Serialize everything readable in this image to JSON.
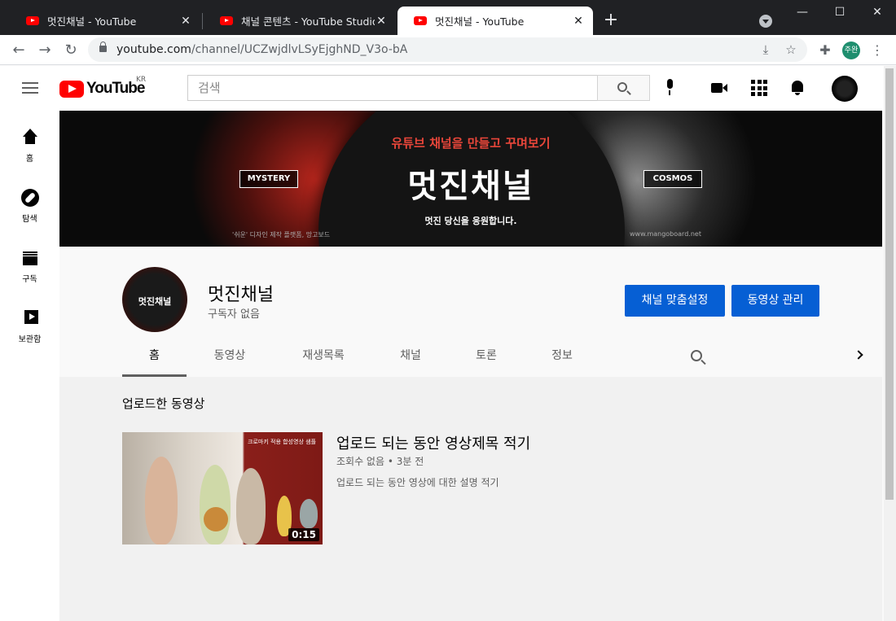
{
  "browser": {
    "tabs": [
      {
        "title": "멋진채널 - YouTube",
        "close": "✕"
      },
      {
        "title": "채널 콘텐츠 - YouTube Studio",
        "close": "✕"
      },
      {
        "title": "멋진채널 - YouTube",
        "close": "✕"
      }
    ],
    "new_tab": "+",
    "window_controls": {
      "minimize": "—",
      "maximize": "☐",
      "close": "✕"
    },
    "url_host": "youtube.com",
    "url_path": "/channel/UCZwjdlvLSyEjghND_V3o-bA",
    "profile_initials": "주완"
  },
  "masthead": {
    "logo_text": "YouTube",
    "region": "KR",
    "search_placeholder": "검색"
  },
  "guide": [
    {
      "label": "홈",
      "icon": "home-icon"
    },
    {
      "label": "탐색",
      "icon": "explore-icon"
    },
    {
      "label": "구독",
      "icon": "subscriptions-icon"
    },
    {
      "label": "보관함",
      "icon": "library-icon"
    }
  ],
  "banner": {
    "top_text": "유튜브 채널을 만들고 꾸며보기",
    "title": "멋진채널",
    "subtitle": "멋진 당신을 응원합니다.",
    "left_tag": "MYSTERY",
    "right_tag": "COSMOS",
    "credit": "'쉬운' 디자인 제작 플랫폼, 망고보드",
    "site": "www.mangoboard.net"
  },
  "channel": {
    "name": "멋진채널",
    "subscribers": "구독자 없음",
    "avatar_text": "멋진채널",
    "customize_button": "채널 맞춤설정",
    "manage_button": "동영상 관리",
    "tabs": [
      "홈",
      "동영상",
      "재생목록",
      "채널",
      "토론",
      "정보"
    ]
  },
  "content": {
    "section_title": "업로드한 동영상",
    "video": {
      "title": "업로드 되는 동안 영상제목 적기",
      "meta": "조회수 없음 • 3분 전",
      "description": "업로드 되는 동안 영상에 대한 설명 적기",
      "duration": "0:15",
      "thumb_text": "크로마키 적용 합성영상 샘플"
    }
  }
}
